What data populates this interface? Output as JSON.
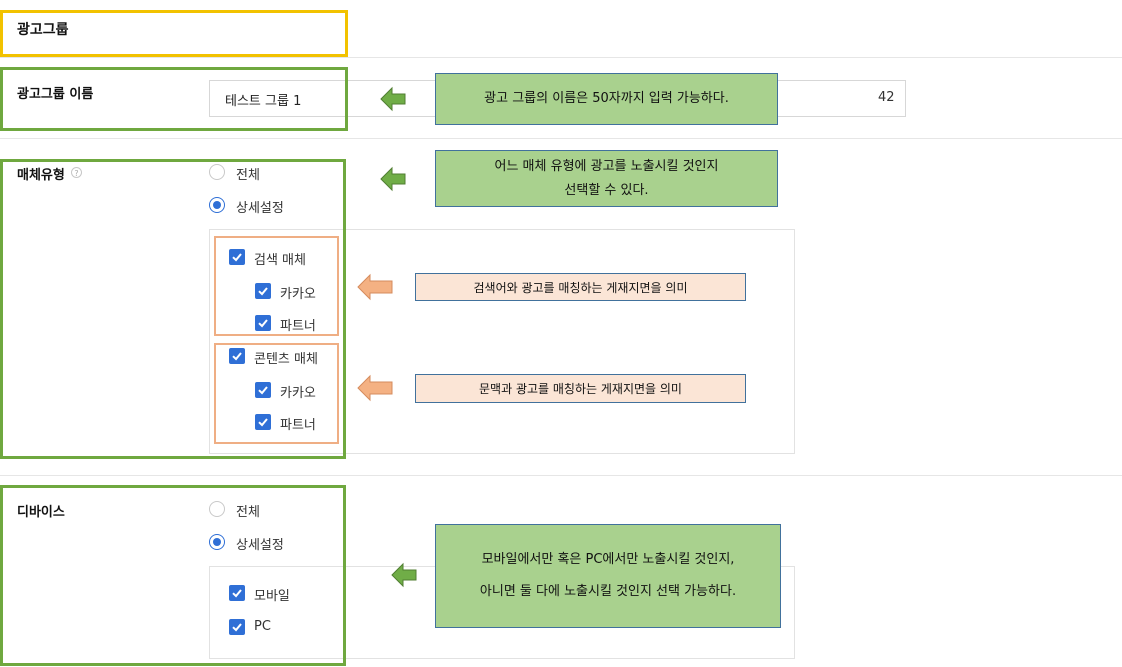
{
  "adgroup": {
    "title": "광고그룹"
  },
  "name_section": {
    "label": "광고그룹 이름",
    "input_value": "테스트 그룹 1",
    "char_count": "42"
  },
  "media_section": {
    "label": "매체유형",
    "help_glyph": "?",
    "radio_all": "전체",
    "radio_detail": "상세설정",
    "search_media": {
      "label": "검색 매체",
      "children": [
        "카카오",
        "파트너"
      ]
    },
    "content_media": {
      "label": "콘텐츠 매체",
      "children": [
        "카카오",
        "파트너"
      ]
    }
  },
  "device_section": {
    "label": "디바이스",
    "radio_all": "전체",
    "radio_detail": "상세설정",
    "options": [
      "모바일",
      "PC"
    ]
  },
  "annotations": {
    "name_note": "광고 그룹의 이름은 50자까지 입력 가능하다.",
    "media_note": "어느 매체 유형에 광고를 노출시킬 것인지\n선택할 수 있다.",
    "search_note": "검색어와 광고를 매칭하는 게재지면을 의미",
    "content_note": "문맥과 광고를 매칭하는 게재지면을 의미",
    "device_note": "모바일에서만 혹은 PC에서만 노출시킬 것인지,\n아니면 둘 다에 노출시킬 것인지 선택 가능하다."
  },
  "colors": {
    "accent": "#2f6fd6",
    "frame_yellow": "#f2c200",
    "frame_green": "#6fa83f",
    "frame_orange": "#efae84",
    "note_green": "#a9d18e",
    "note_peach": "#fbe5d6",
    "arrow_green": "#70ad47",
    "arrow_orange": "#f4b183"
  },
  "icons": {
    "arrow_left": "arrow-left-icon",
    "checkmark": "check-icon",
    "help": "help-icon"
  }
}
